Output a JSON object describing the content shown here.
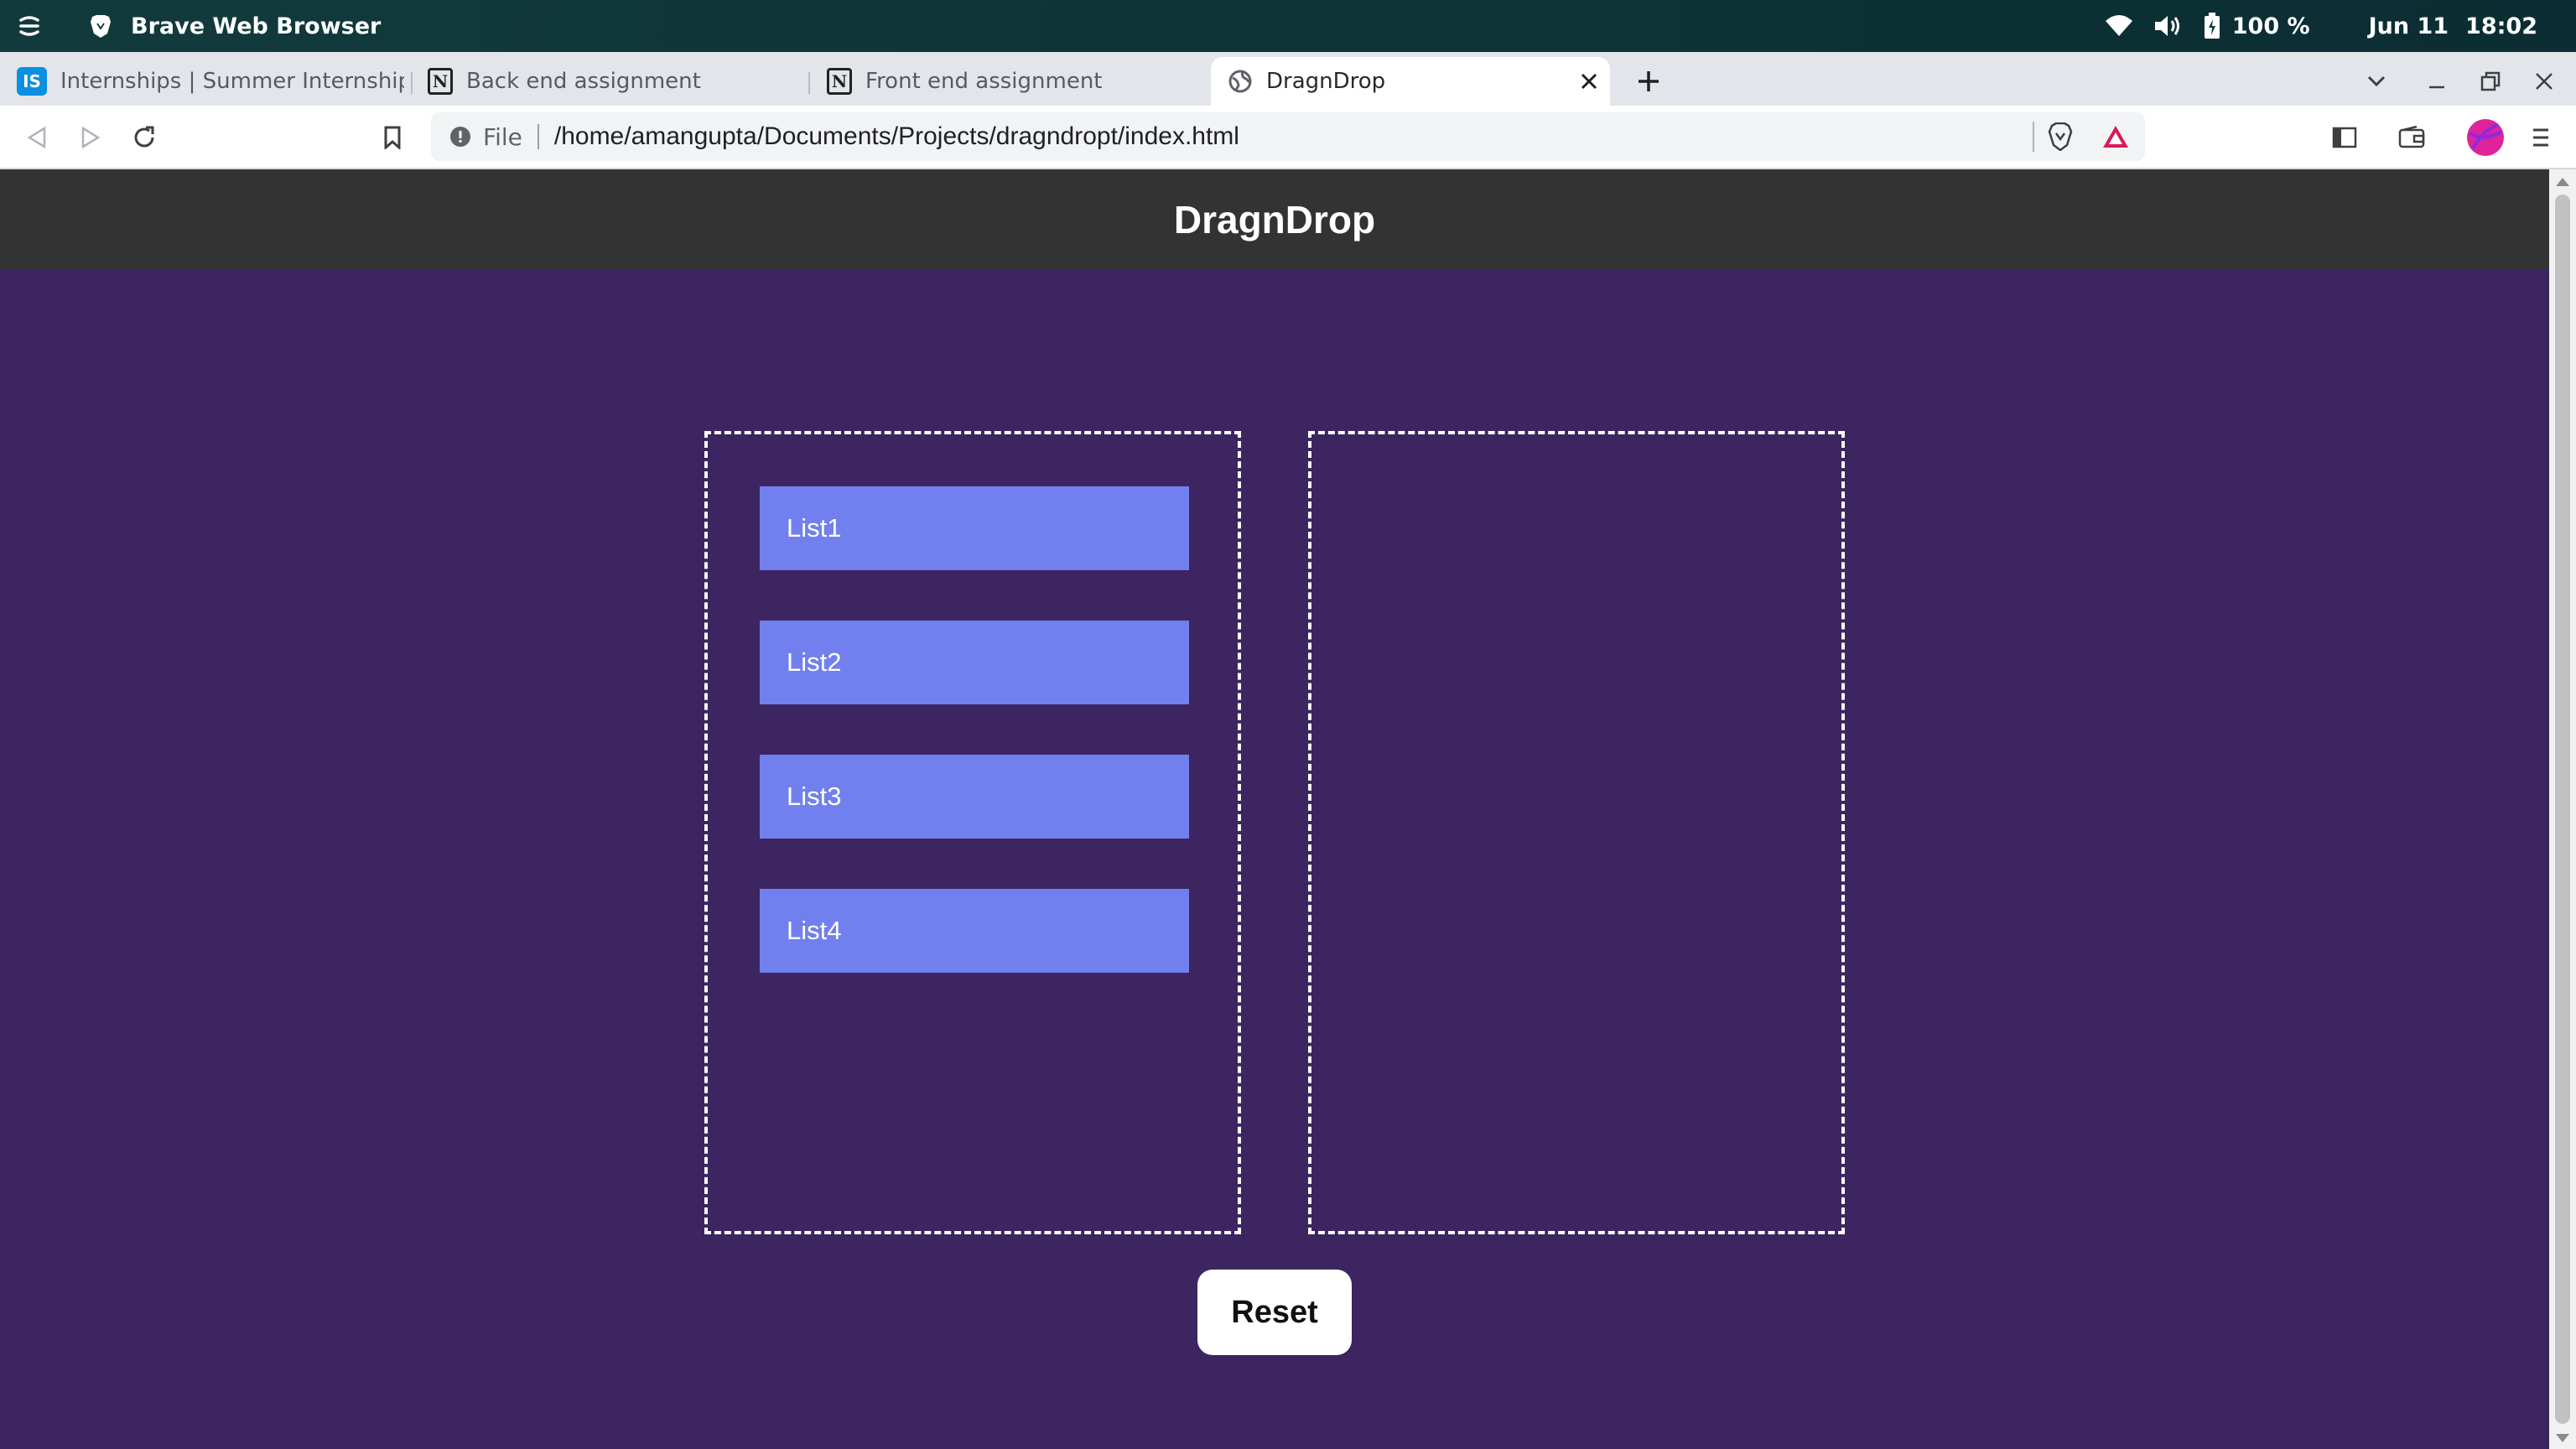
{
  "os": {
    "app_name": "Brave Web Browser",
    "battery": "100 %",
    "date": "Jun 11",
    "time": "18:02"
  },
  "tabs": [
    {
      "label": "Internships | Summer Internship",
      "favicon": "IS",
      "icon": "internshala-icon",
      "active": false
    },
    {
      "label": "Back end assignment",
      "favicon": "N",
      "icon": "notion-icon",
      "active": false
    },
    {
      "label": "Front end assignment",
      "favicon": "N",
      "icon": "notion-icon",
      "active": false
    },
    {
      "label": "DragnDrop",
      "icon": "globe-icon",
      "active": true
    }
  ],
  "address_bar": {
    "scheme_label": "File",
    "url": "/home/amangupta/Documents/Projects/dragndropt/index.html"
  },
  "page": {
    "title": "DragnDrop",
    "left_list": [
      "List1",
      "List2",
      "List3",
      "List4"
    ],
    "right_list": [],
    "reset_label": "Reset"
  },
  "colors": {
    "page_background": "#3c2561",
    "header_background": "#333333",
    "list_item": "#7180ee",
    "box_border": "#ffffff"
  }
}
